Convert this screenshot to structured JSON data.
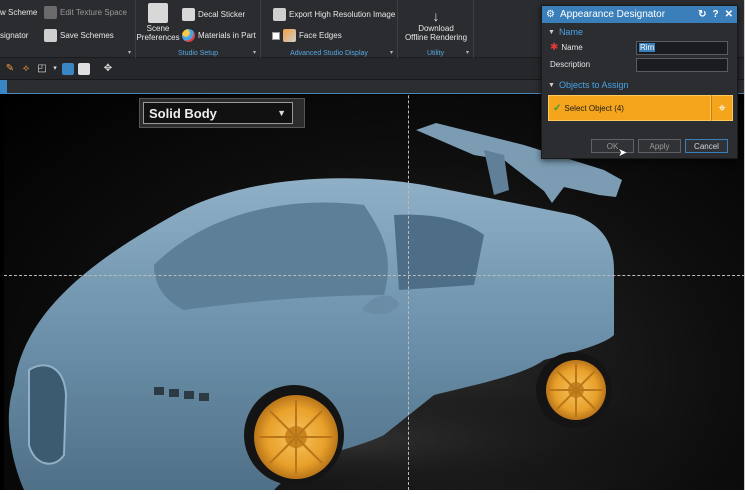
{
  "ribbon": {
    "buttons": {
      "new_scheme": "w Scheme",
      "edit_texture_space": "Edit Texture Space",
      "assignator": "signator",
      "save_schemes": "Save Schemes",
      "scene_preferences": "Scene\nPreferences",
      "decal_sticker": "Decal Sticker",
      "materials_in_part": "Materials in Part",
      "export_high_res": "Export High Resolution Image",
      "face_edges": "Face Edges",
      "download_offline": "Download\nOffline Rendering"
    },
    "groups": {
      "studio_setup": "Studio Setup",
      "advanced_studio_display": "Advanced Studio Display",
      "utility": "Utility"
    }
  },
  "viewport": {
    "display_mode": "Solid Body"
  },
  "dialog": {
    "title": "Appearance Designator",
    "controls": {
      "reset": "↻",
      "help": "?",
      "close": "✕"
    },
    "name_section": "Name",
    "name_label": "Name",
    "name_value": "Rim",
    "description_label": "Description",
    "description_value": "",
    "objects_section": "Objects to Assign",
    "select_object": "Select Object (4)",
    "buttons": {
      "ok": "OK",
      "apply": "Apply",
      "cancel": "Cancel"
    }
  },
  "colors": {
    "car_body": "#6f93ad",
    "rim": "#e8a02a",
    "accent": "#3a7fb9",
    "selection": "#f4a51c"
  }
}
